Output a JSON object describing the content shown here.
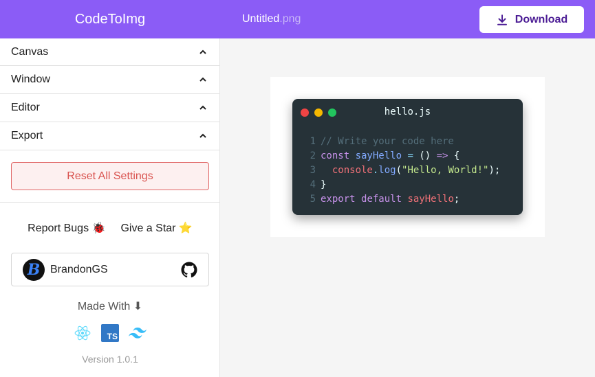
{
  "header": {
    "brand": "CodeToImg",
    "filename": "Untitled",
    "extension": ".png",
    "download_label": "Download"
  },
  "sidebar": {
    "sections": [
      {
        "label": "Canvas",
        "name": "canvas"
      },
      {
        "label": "Window",
        "name": "window"
      },
      {
        "label": "Editor",
        "name": "editor"
      },
      {
        "label": "Export",
        "name": "export"
      }
    ],
    "reset_label": "Reset All Settings",
    "report_bugs": "Report Bugs 🐞",
    "give_star": "Give a Star ⭐",
    "profile_name": "BrandonGS",
    "avatar_letter": "B",
    "made_with": "Made With ⬇",
    "tech_icons": [
      "react-icon",
      "typescript-icon",
      "tailwind-icon"
    ],
    "ts_badge": "TS",
    "version": "Version 1.0.1"
  },
  "preview": {
    "window_title": "hello.js",
    "dots": [
      "#ef4444",
      "#f5b800",
      "#22c55e"
    ],
    "code": [
      {
        "n": "1",
        "tokens": [
          {
            "t": "// Write your code here",
            "c": "cm"
          }
        ]
      },
      {
        "n": "2",
        "tokens": [
          {
            "t": "const ",
            "c": "kw"
          },
          {
            "t": "sayHello",
            "c": "fn"
          },
          {
            "t": " = ",
            "c": "op"
          },
          {
            "t": "() ",
            "c": "pl"
          },
          {
            "t": "=>",
            "c": "kw"
          },
          {
            "t": " {",
            "c": "pl"
          }
        ]
      },
      {
        "n": "3",
        "tokens": [
          {
            "t": "  console",
            "c": "prop"
          },
          {
            "t": ".",
            "c": "op"
          },
          {
            "t": "log",
            "c": "fn"
          },
          {
            "t": "(",
            "c": "pl"
          },
          {
            "t": "\"Hello, World!\"",
            "c": "str"
          },
          {
            "t": ");",
            "c": "pl"
          }
        ]
      },
      {
        "n": "4",
        "tokens": [
          {
            "t": "}",
            "c": "pl"
          }
        ]
      },
      {
        "n": "5",
        "tokens": [
          {
            "t": "export ",
            "c": "kw"
          },
          {
            "t": "default ",
            "c": "kw"
          },
          {
            "t": "sayHello",
            "c": "prop"
          },
          {
            "t": ";",
            "c": "pl"
          }
        ]
      }
    ]
  },
  "colors": {
    "accent": "#8b5cf6",
    "editor_bg": "#263238",
    "reset_red": "#d9534f"
  }
}
